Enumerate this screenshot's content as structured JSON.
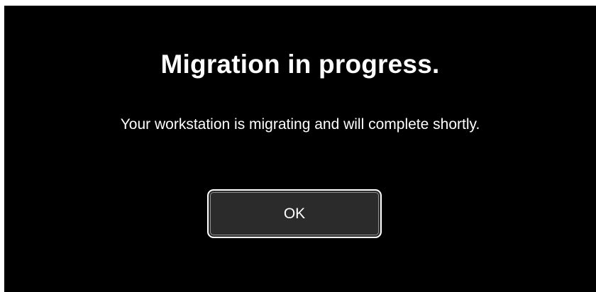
{
  "dialog": {
    "title": "Migration in progress.",
    "message": "Your workstation is migrating and will complete shortly.",
    "ok_label": "OK"
  },
  "colors": {
    "background": "#000000",
    "text": "#ffffff",
    "button_fill": "#2b2b2b",
    "button_border": "#ffffff"
  }
}
